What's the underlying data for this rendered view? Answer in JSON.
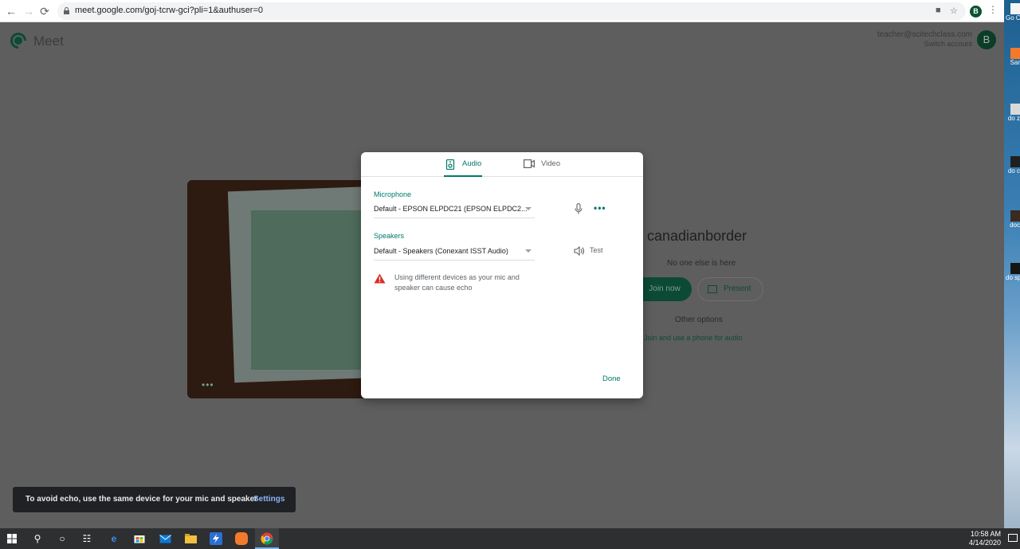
{
  "browser": {
    "url": "meet.google.com/goj-tcrw-gci?pli=1&authuser=0",
    "profile_initial": "B"
  },
  "meet": {
    "app_name": "Meet",
    "account_email": "teacher@scitechclass.com",
    "switch_account": "Switch account",
    "avatar_initial": "B",
    "meeting_name": "canadianborder",
    "no_one_text": "No one else is here",
    "join_now": "Join now",
    "present": "Present",
    "other_options": "Other options",
    "phone_audio": "Join and use a phone for audio",
    "preview_more": "•••"
  },
  "dialog": {
    "tabs": [
      {
        "label": "Audio",
        "selected": true
      },
      {
        "label": "Video",
        "selected": false
      }
    ],
    "microphone_label": "Microphone",
    "microphone_value": "Default - EPSON ELPDC21 (EPSON ELPDC2...",
    "speakers_label": "Speakers",
    "speakers_value": "Default - Speakers (Conexant ISST Audio)",
    "test_label": "Test",
    "more": "•••",
    "warning": "Using different devices as your mic and speaker can cause echo",
    "done": "Done"
  },
  "toast": {
    "message": "To avoid echo, use the same device for your mic and speaker",
    "action": "Settings"
  },
  "desktop_icons": [
    {
      "label": "Go Ch",
      "color": "#f4f4f4"
    },
    {
      "label": "Sar",
      "color": "#f47a2b"
    },
    {
      "label": "do z",
      "color": "#d9d9d9"
    },
    {
      "label": "do c",
      "color": "#202020"
    },
    {
      "label": "doc",
      "color": "#3a2a20"
    },
    {
      "label": "do spo",
      "color": "#151515"
    }
  ],
  "taskbar": {
    "time": "10:58 AM",
    "date": "4/14/2020"
  },
  "colors": {
    "accent": "#00796b",
    "join_button": "#0c4a35",
    "warning": "#d93025"
  }
}
